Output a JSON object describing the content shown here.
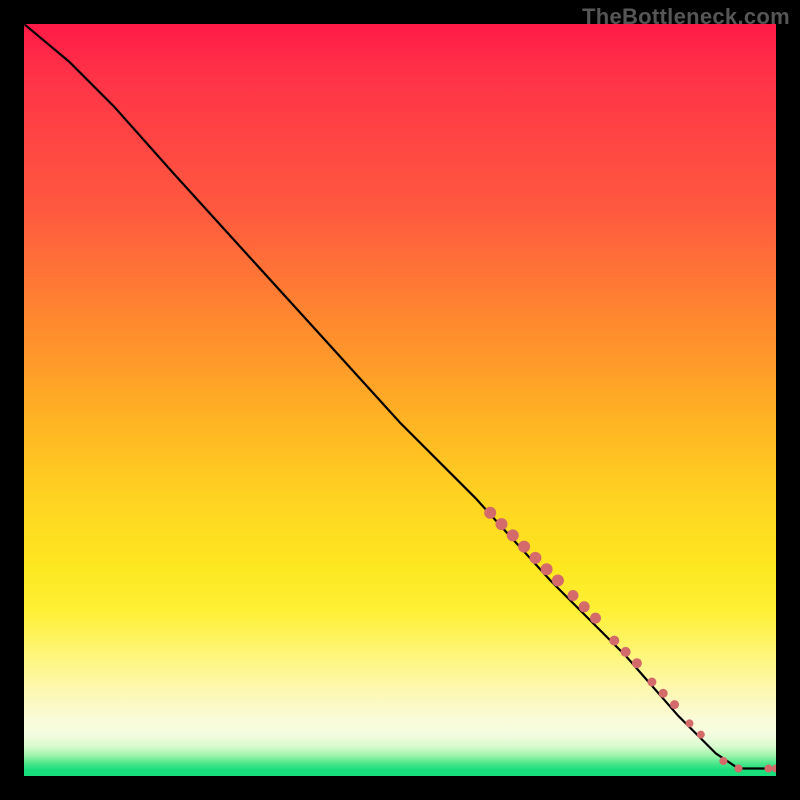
{
  "watermark": "TheBottleneck.com",
  "chart_data": {
    "type": "line",
    "xlabel": "",
    "ylabel": "",
    "xlim": [
      0,
      100
    ],
    "ylim": [
      0,
      100
    ],
    "grid": false,
    "legend": false,
    "series": [
      {
        "name": "curve",
        "points": [
          {
            "x": 0,
            "y": 100
          },
          {
            "x": 6,
            "y": 95
          },
          {
            "x": 12,
            "y": 89
          },
          {
            "x": 20,
            "y": 80
          },
          {
            "x": 30,
            "y": 69
          },
          {
            "x": 40,
            "y": 58
          },
          {
            "x": 50,
            "y": 47
          },
          {
            "x": 60,
            "y": 37
          },
          {
            "x": 70,
            "y": 26
          },
          {
            "x": 80,
            "y": 16
          },
          {
            "x": 87,
            "y": 8
          },
          {
            "x": 92,
            "y": 3
          },
          {
            "x": 95,
            "y": 1
          },
          {
            "x": 100,
            "y": 1
          }
        ]
      }
    ],
    "dots": [
      {
        "x": 62,
        "y": 35,
        "r": 6
      },
      {
        "x": 63.5,
        "y": 33.5,
        "r": 6
      },
      {
        "x": 65,
        "y": 32,
        "r": 6
      },
      {
        "x": 66.5,
        "y": 30.5,
        "r": 6
      },
      {
        "x": 68,
        "y": 29,
        "r": 6
      },
      {
        "x": 69.5,
        "y": 27.5,
        "r": 6
      },
      {
        "x": 71,
        "y": 26,
        "r": 6
      },
      {
        "x": 73,
        "y": 24,
        "r": 5.5
      },
      {
        "x": 74.5,
        "y": 22.5,
        "r": 5.5
      },
      {
        "x": 76,
        "y": 21,
        "r": 5.5
      },
      {
        "x": 78.5,
        "y": 18,
        "r": 5
      },
      {
        "x": 80,
        "y": 16.5,
        "r": 5
      },
      {
        "x": 81.5,
        "y": 15,
        "r": 5
      },
      {
        "x": 83.5,
        "y": 12.5,
        "r": 4.5
      },
      {
        "x": 85,
        "y": 11,
        "r": 4.5
      },
      {
        "x": 86.5,
        "y": 9.5,
        "r": 4.5
      },
      {
        "x": 88.5,
        "y": 7,
        "r": 4
      },
      {
        "x": 90,
        "y": 5.5,
        "r": 4
      },
      {
        "x": 93,
        "y": 2,
        "r": 4
      },
      {
        "x": 95,
        "y": 1,
        "r": 4
      },
      {
        "x": 99,
        "y": 1,
        "r": 4
      },
      {
        "x": 100,
        "y": 1,
        "r": 4
      }
    ]
  }
}
